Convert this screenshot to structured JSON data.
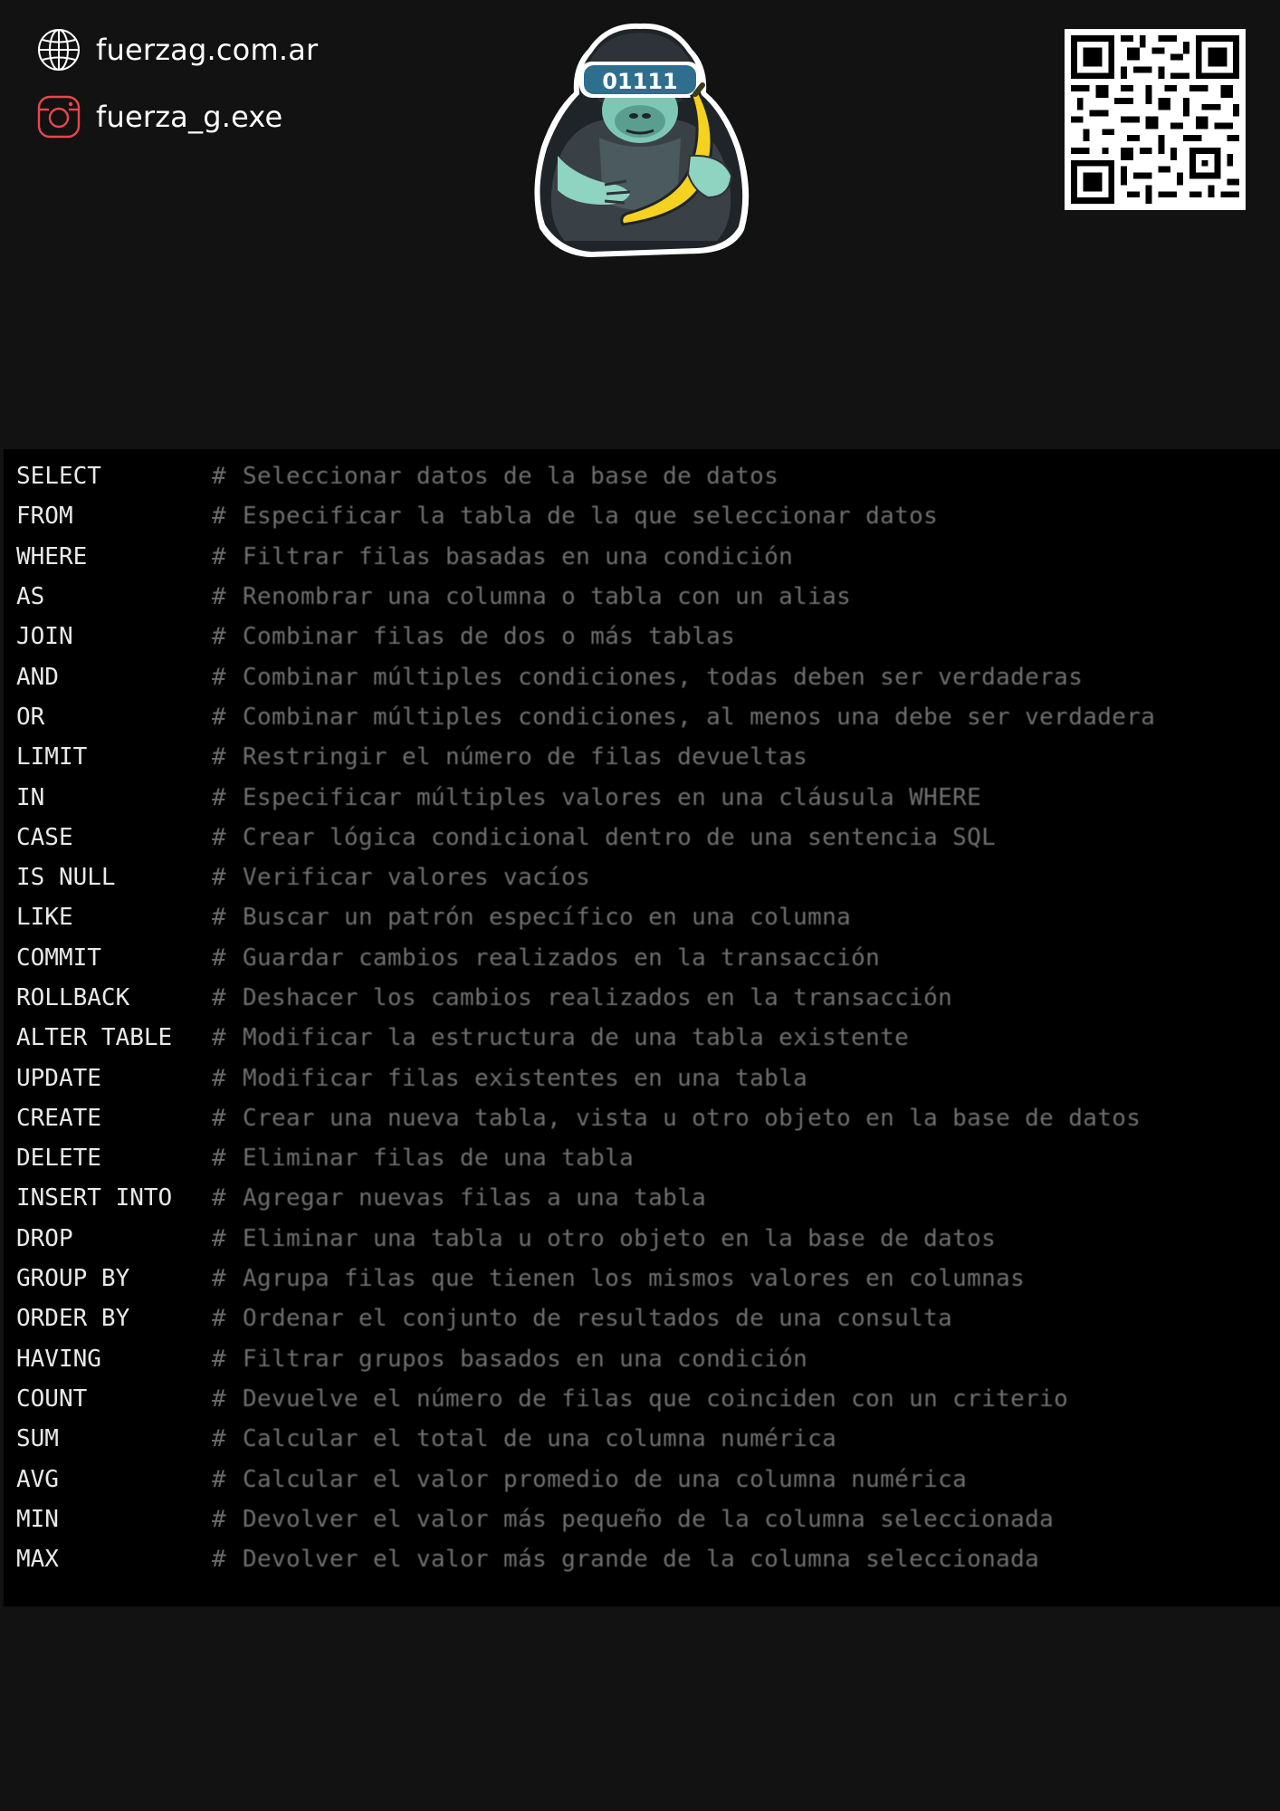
{
  "header": {
    "website": "fuerzag.com.ar",
    "instagram": "fuerza_g.exe",
    "logo_label": "01111",
    "icons": {
      "website": "globe-icon",
      "instagram": "instagram-icon",
      "qr": "qr-code"
    },
    "colors": {
      "instagram_icon": "#e8474c",
      "logo_visor": "#2e6f8e",
      "banana": "#f5d21f"
    }
  },
  "comment_prefix": "#",
  "commands": [
    {
      "keyword": "SELECT",
      "description": "Seleccionar datos de la base de datos"
    },
    {
      "keyword": "FROM",
      "description": "Especificar la tabla de la que seleccionar datos"
    },
    {
      "keyword": "WHERE",
      "description": "Filtrar filas basadas en una condición"
    },
    {
      "keyword": "AS",
      "description": "Renombrar una columna o tabla con un alias"
    },
    {
      "keyword": "JOIN",
      "description": "Combinar filas de dos o más tablas"
    },
    {
      "keyword": "AND",
      "description": "Combinar múltiples condiciones, todas deben ser verdaderas"
    },
    {
      "keyword": "OR",
      "description": "Combinar múltiples condiciones, al menos una debe ser verdadera"
    },
    {
      "keyword": "LIMIT",
      "description": "Restringir el número de filas devueltas"
    },
    {
      "keyword": "IN",
      "description": "Especificar múltiples valores en una cláusula WHERE"
    },
    {
      "keyword": "CASE",
      "description": "Crear lógica condicional dentro de una sentencia SQL"
    },
    {
      "keyword": "IS NULL",
      "description": "Verificar valores vacíos"
    },
    {
      "keyword": "LIKE",
      "description": "Buscar un patrón específico en una columna"
    },
    {
      "keyword": "COMMIT",
      "description": "Guardar cambios realizados en la transacción"
    },
    {
      "keyword": "ROLLBACK",
      "description": "Deshacer los cambios realizados en la transacción"
    },
    {
      "keyword": "ALTER TABLE",
      "description": "Modificar la estructura de una tabla existente"
    },
    {
      "keyword": "UPDATE",
      "description": "Modificar filas existentes en una tabla"
    },
    {
      "keyword": "CREATE",
      "description": "Crear una nueva tabla, vista u otro objeto en la base de datos"
    },
    {
      "keyword": "DELETE",
      "description": "Eliminar filas de una tabla"
    },
    {
      "keyword": "INSERT INTO",
      "description": "Agregar nuevas filas a una tabla"
    },
    {
      "keyword": "DROP",
      "description": "Eliminar una tabla u otro objeto en la base de datos"
    },
    {
      "keyword": "GROUP BY",
      "description": "Agrupa filas que tienen los mismos valores en columnas"
    },
    {
      "keyword": "ORDER BY",
      "description": "Ordenar el conjunto de resultados de una consulta"
    },
    {
      "keyword": "HAVING",
      "description": "Filtrar grupos basados en una condición"
    },
    {
      "keyword": "COUNT",
      "description": "Devuelve el número de filas que coinciden con un criterio"
    },
    {
      "keyword": "SUM",
      "description": "Calcular el total de una columna numérica"
    },
    {
      "keyword": "AVG",
      "description": "Calcular el valor promedio de una columna numérica"
    },
    {
      "keyword": "MIN",
      "description": "Devolver el valor más pequeño de la columna seleccionada"
    },
    {
      "keyword": "MAX",
      "description": "Devolver el valor más grande de la columna seleccionada"
    }
  ]
}
